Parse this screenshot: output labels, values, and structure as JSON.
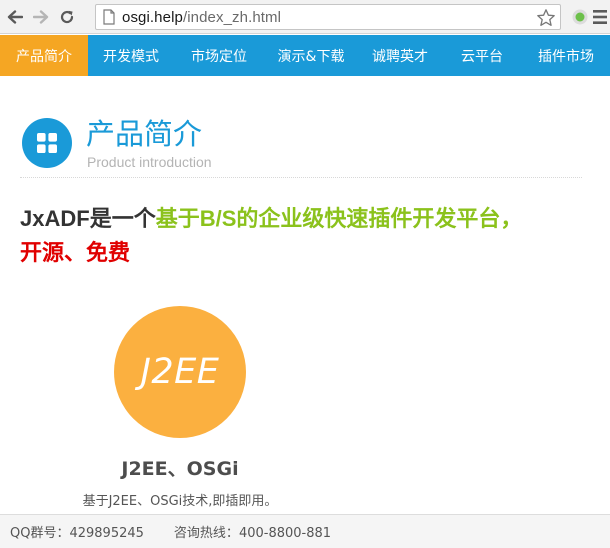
{
  "browser": {
    "url_domain": "osgi.help",
    "url_path": "/index_zh.html"
  },
  "nav": {
    "items": [
      {
        "label": "产品简介",
        "active": true
      },
      {
        "label": "开发模式",
        "active": false
      },
      {
        "label": "市场定位",
        "active": false
      },
      {
        "label": "演示&下载",
        "active": false
      },
      {
        "label": "诚聘英才",
        "active": false
      },
      {
        "label": "云平台",
        "active": false
      },
      {
        "label": "插件市场",
        "active": false
      }
    ]
  },
  "section": {
    "title": "产品简介",
    "subtitle": "Product introduction"
  },
  "headline": {
    "part1": "JxADF",
    "part2": "是一个",
    "part3": "基于",
    "part4": "B/S",
    "part5": "的企业级快速插件开发平台，",
    "part6": "开源、免费"
  },
  "feature": {
    "circle_text": "J2EE",
    "title": "J2EE、OSGi",
    "description": "基于J2EE、OSGi技术,即插即用。"
  },
  "footer": {
    "qq_label": "QQ群号：",
    "qq_value": "429895245",
    "hotline_label": "咨询热线：",
    "hotline_value": "400-8800-881"
  },
  "colors": {
    "nav_blue": "#1a9ad8",
    "nav_active": "#f5a623",
    "accent_green": "#8bc21c",
    "accent_red": "#e00000",
    "feature_orange": "#fbb040"
  }
}
